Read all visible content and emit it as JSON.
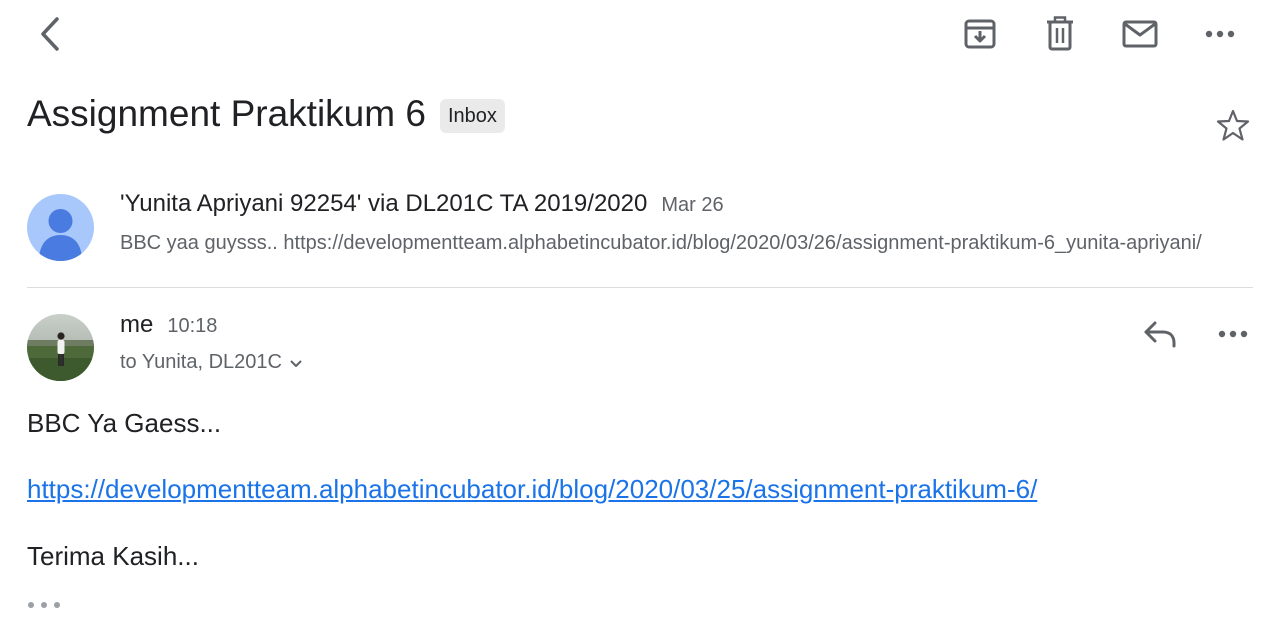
{
  "toolbar": {
    "back_icon": "chevron-left-icon",
    "archive_icon": "archive-icon",
    "delete_icon": "trash-icon",
    "mark_unread_icon": "mail-icon",
    "more_icon": "more-horizontal-icon"
  },
  "thread": {
    "subject": "Assignment Praktikum 6",
    "label": "Inbox",
    "star_icon": "star-outline-icon"
  },
  "messages": [
    {
      "sender": "'Yunita Apriyani 92254' via DL201C TA 2019/2020",
      "date": "Mar 26",
      "snippet": "BBC yaa guysss.. https://developmentteam.alphabetincubator.id/blog/2020/03/26/assignment-praktikum-6_yunita-apriyani/",
      "avatar": "default-person-avatar"
    },
    {
      "sender": "me",
      "time": "10:18",
      "recipients": "to Yunita, DL201C",
      "avatar": "photo-avatar",
      "reply_icon": "reply-icon",
      "more_icon": "more-horizontal-icon",
      "body": {
        "line1": "BBC Ya Gaess...",
        "link": "https://developmentteam.alphabetincubator.id/blog/2020/03/25/assignment-praktikum-6/",
        "line3": "Terima Kasih..."
      },
      "trimmed_content_icon": "more-horizontal-icon"
    }
  ],
  "colors": {
    "link": "#1a73e8",
    "text": "#202124",
    "secondary_text": "#5f6368",
    "avatar_bg": "#a8c7fa",
    "avatar_fg": "#4a7be0",
    "icon": "#5f6368"
  }
}
